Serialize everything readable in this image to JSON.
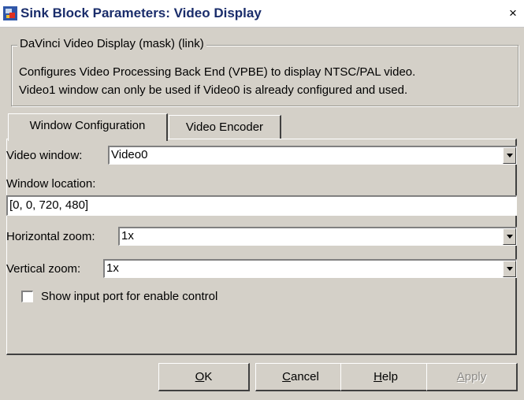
{
  "window": {
    "title": "Sink Block Parameters: Video Display",
    "close_glyph": "×"
  },
  "description": {
    "legend": "DaVinci Video Display (mask) (link)",
    "line1": "Configures Video Processing Back End (VPBE) to display NTSC/PAL video.",
    "line2": "Video1 window can only be used if Video0 is already configured and used."
  },
  "tabs": [
    {
      "label": "Window Configuration",
      "active": true
    },
    {
      "label": "Video Encoder",
      "active": false
    }
  ],
  "fields": {
    "video_window_label": "Video window:",
    "video_window_value": "Video0",
    "window_location_label": "Window location:",
    "window_location_value": "[0, 0, 720, 480]",
    "horizontal_zoom_label": "Horizontal zoom:",
    "horizontal_zoom_value": "1x",
    "vertical_zoom_label": "Vertical zoom:",
    "vertical_zoom_value": "1x",
    "enable_control_label": "Show input port for enable control",
    "enable_control_checked": false
  },
  "buttons": {
    "ok_key": "O",
    "ok_rest": "K",
    "cancel_key": "C",
    "cancel_rest": "ancel",
    "help_key": "H",
    "help_rest": "elp",
    "apply_key": "A",
    "apply_rest": "pply"
  },
  "icons": {
    "app": "simulink-block-icon",
    "close": "close-icon",
    "dropdown": "chevron-down-icon"
  }
}
